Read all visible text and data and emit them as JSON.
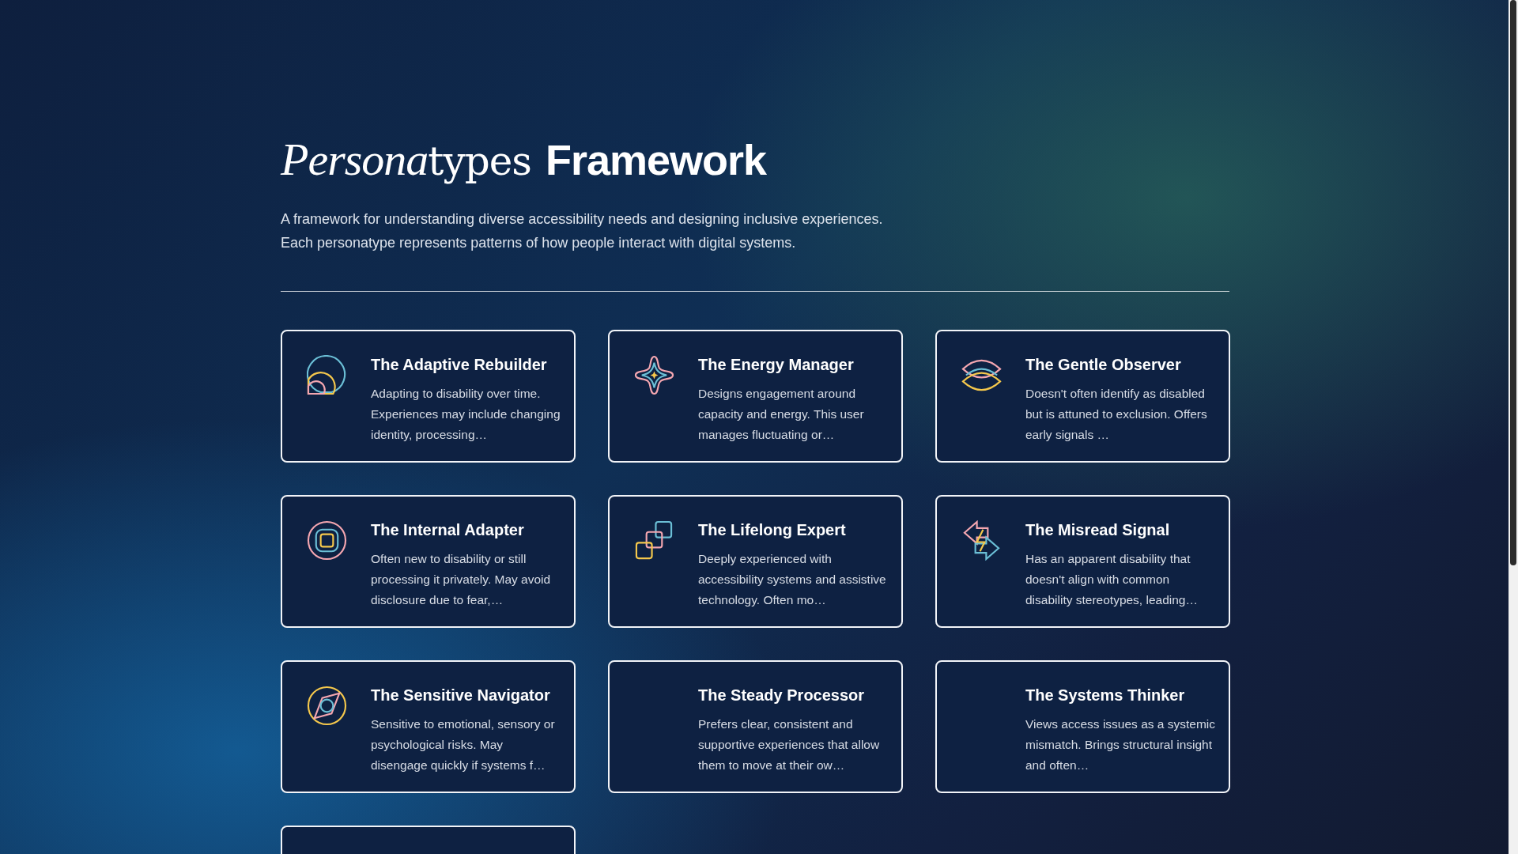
{
  "header": {
    "title_italic": "Persona",
    "title_rest": "types",
    "title_bold": "Framework",
    "intro_lines": [
      "A framework for understanding diverse accessibility needs and designing inclusive experiences.",
      "Each personatype represents patterns of how people interact with digital systems."
    ]
  },
  "cards": [
    {
      "title": "The Adaptive Rebuilder",
      "description": "Adapting to disability over time. Experiences may include changing identity, processing…"
    },
    {
      "title": "The Energy Manager",
      "description": "Designs engagement around capacity and energy. This user manages fluctuating or…"
    },
    {
      "title": "The Gentle Observer",
      "description": "Doesn't often identify as disabled but is attuned to exclusion. Offers early signals …"
    },
    {
      "title": "The Internal Adapter",
      "description": "Often new to disability or still processing it privately. May avoid disclosure due to fear,…"
    },
    {
      "title": "The Lifelong Expert",
      "description": "Deeply experienced with accessibility systems and assistive technology. Often mo…"
    },
    {
      "title": "The Misread Signal",
      "description": "Has an apparent disability that doesn't align with common disability stereotypes, leading…"
    },
    {
      "title": "The Sensitive Navigator",
      "description": "Sensitive to emotional, sensory or psychological risks. May disengage quickly if systems f…"
    },
    {
      "title": "The Steady Processor",
      "description": "Prefers clear, consistent and supportive experiences that allow them to move at their ow…"
    },
    {
      "title": "The Systems Thinker",
      "description": "Views access issues as a systemic mismatch. Brings structural insight and often…"
    }
  ]
}
